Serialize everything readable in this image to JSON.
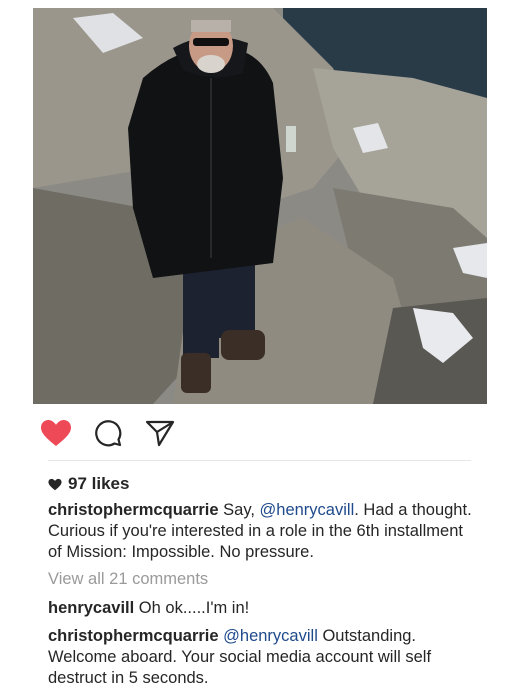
{
  "post": {
    "photo_description_icon": "photo",
    "actions": [
      {
        "name": "like-button",
        "icon": "heart-filled-icon",
        "color": "#ed4956"
      },
      {
        "name": "comment-button",
        "icon": "comment-bubble-icon"
      },
      {
        "name": "share-button",
        "icon": "paper-plane-icon"
      }
    ],
    "likes_label": "97 likes",
    "caption": {
      "user": "christophermcquarrie",
      "text_before": " Say, ",
      "mention": "@henrycavill",
      "text_after": ". Had a thought. Curious if you're interested in a role in the 6th installment of Mission: Impossible. No pressure."
    },
    "view_all_comments": "View all 21 comments",
    "comments": [
      {
        "user": "henrycavill",
        "text": " Oh ok.....I'm in!"
      },
      {
        "user": "christophermcquarrie",
        "mention": "@henrycavill",
        "text": " Outstanding. Welcome aboard. Your social media account will self destruct in 5 seconds."
      }
    ]
  },
  "colors": {
    "heart": "#ed4956",
    "mention": "#1f4a8c",
    "muted": "#9a9a9a"
  }
}
